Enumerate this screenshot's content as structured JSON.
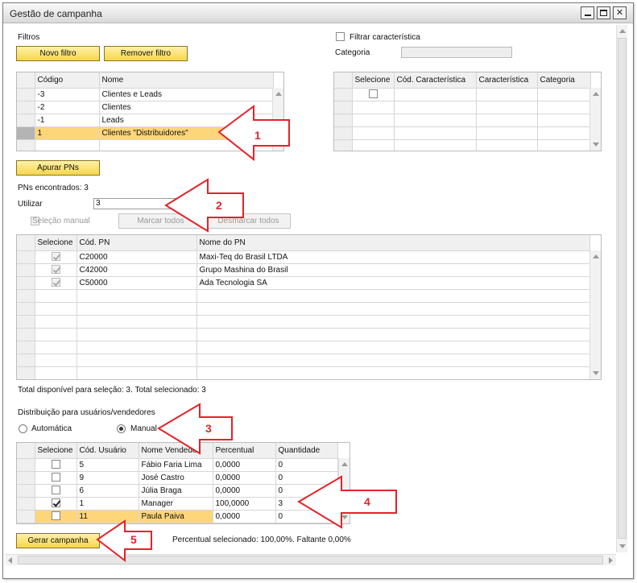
{
  "window": {
    "title": "Gestão de campanha"
  },
  "filters": {
    "label": "Filtros",
    "new_filter": "Novo filtro",
    "remove_filter": "Remover filtro",
    "columns": [
      "Código",
      "Nome"
    ],
    "rows": [
      {
        "code": "-3",
        "name": "Clientes e Leads"
      },
      {
        "code": "-2",
        "name": "Clientes"
      },
      {
        "code": "-1",
        "name": "Leads"
      },
      {
        "code": "1",
        "name": "Clientes \"Distribuidores\""
      }
    ]
  },
  "characteristics": {
    "filter_label": "Filtrar característica",
    "category_label": "Categoria",
    "columns": [
      "Selecione",
      "Cód. Característica",
      "Característica",
      "Categoria"
    ]
  },
  "bp": {
    "search_button": "Apurar PNs",
    "found": "PNs encontrados: 3",
    "use_label": "Utilizar",
    "use_value": "3",
    "manual_selection": "Seleção manual",
    "mark_all": "Marcar todos",
    "unmark_all": "Desmarcar todos",
    "columns": [
      "Selecione",
      "Cód. PN",
      "Nome do PN"
    ],
    "rows": [
      {
        "code": "C20000",
        "name": "Maxi-Teq do Brasil LTDA"
      },
      {
        "code": "C42000",
        "name": "Grupo Mashina do Brasil"
      },
      {
        "code": "C50000",
        "name": "Ada Tecnologia SA"
      }
    ],
    "total": "Total disponível para seleção: 3. Total selecionado: 3"
  },
  "distribution": {
    "label": "Distribuição para usuários/vendedores",
    "auto": "Automática",
    "manual": "Manual",
    "columns": [
      "Selecione",
      "Cód. Usuário",
      "Nome Vendedor",
      "Percentual",
      "Quantidade"
    ],
    "rows": [
      {
        "checked": false,
        "code": "5",
        "name": "Fábio Faria Lima",
        "pct": "0,0000",
        "qty": "0"
      },
      {
        "checked": false,
        "code": "9",
        "name": "José Castro",
        "pct": "0,0000",
        "qty": "0"
      },
      {
        "checked": false,
        "code": "6",
        "name": "Júlia Braga",
        "pct": "0,0000",
        "qty": "0"
      },
      {
        "checked": true,
        "code": "1",
        "name": "Manager",
        "pct": "100,0000",
        "qty": "3"
      },
      {
        "checked": false,
        "code": "11",
        "name": "Paula Paiva",
        "pct": "0,0000",
        "qty": "0"
      }
    ],
    "percent_info": "Percentual selecionado: 100,00%. Faltante 0,00%"
  },
  "generate_button": "Gerar campanha",
  "annotations": [
    "1",
    "2",
    "3",
    "4",
    "5"
  ],
  "colors": {
    "arrow": "#e4222a",
    "button": "#f7d64c",
    "selected_row": "#fdd67a"
  }
}
